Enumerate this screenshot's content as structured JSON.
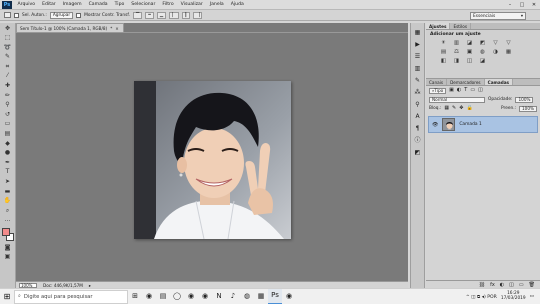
{
  "menubar": {
    "logo": "Ps",
    "items": [
      "Arquivo",
      "Editar",
      "Imagem",
      "Camada",
      "Tipo",
      "Selecionar",
      "Filtro",
      "Visualizar",
      "Janela",
      "Ajuda"
    ],
    "window_controls": [
      "–",
      "□",
      "✕"
    ]
  },
  "options_bar": {
    "feather_label": "Sel. Auton.:",
    "feather_value": "Agrupar",
    "transform_label": "Mostrar Contr. Transf.",
    "workspace_value": "Essenciais"
  },
  "document": {
    "tab_title": "Sem Título-1 @ 100% (Camada 1, RGB/8)",
    "tab_marker": "*",
    "tab_close": "×",
    "zoom": "100%",
    "doc_size": "Doc: 446,9K/1,57M"
  },
  "adjustments": {
    "tabs": [
      "Ajustes",
      "Estilos"
    ],
    "title": "Adicionar um ajuste",
    "row1": [
      "☀",
      "▥",
      "◪",
      "◩",
      "▽",
      "▽"
    ],
    "row2": [
      "▤",
      "⚖",
      "▣",
      "◍",
      "◑",
      "▦"
    ],
    "row3": [
      "◧",
      "◨",
      "◫",
      "◪",
      "",
      ""
    ]
  },
  "layers": {
    "tabs": [
      "Canais",
      "Demarcadores",
      "Camadas"
    ],
    "filter_value": "Tipo",
    "blend_mode": "Normal",
    "opacity_label": "Opacidade:",
    "opacity_value": "100%",
    "lock_label": "Bloq.:",
    "fill_label": "Preen.:",
    "fill_value": "100%",
    "layer_name": "Camada 1",
    "footer_icons": [
      "⛓",
      "fx",
      "◐",
      "◫",
      "▭",
      "🗑"
    ]
  },
  "taskbar": {
    "search_placeholder": "Digite aqui para pesquisar",
    "apps": [
      "⊞",
      "◉",
      "▤",
      "◯",
      "◉",
      "◉",
      "N",
      "♪",
      "◍",
      "▦",
      "Ps",
      "◉"
    ],
    "tray_text": "^ ◫ ⧉ ◂) POR",
    "time": "16:29",
    "date": "17/03/2019"
  },
  "colors": {
    "foreground": "#f28b8b",
    "background": "#ffffff",
    "canvas_bg": "#7a7a7a",
    "selected_layer": "#a9c3e3"
  }
}
